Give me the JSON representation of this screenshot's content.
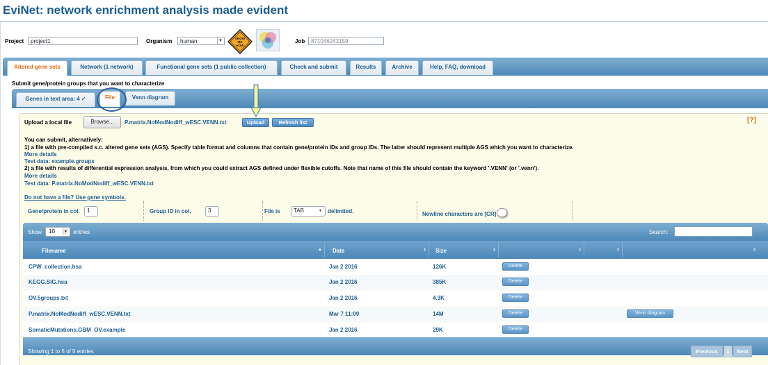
{
  "app": {
    "title": "EviNet: network enrichment analysis made evident"
  },
  "header": {
    "project_label": "Project",
    "project_value": "project1",
    "organism_label": "Organism",
    "organism_value": "human",
    "sign_text": "SHOW ME HOW",
    "job_label": "Job",
    "job_value": "871046243159"
  },
  "tabs": [
    {
      "label": "Altered gene sets"
    },
    {
      "label": "Network (1 network)"
    },
    {
      "label": "Functional gene sets (1 public collection)"
    },
    {
      "label": "Check and submit"
    },
    {
      "label": "Results"
    },
    {
      "label": "Archive"
    },
    {
      "label": "Help, FAQ, download"
    }
  ],
  "submit_title": "Submit gene/protein groups that you want to characterize",
  "subtabs": [
    {
      "label": "Genes in text area: 4 ✓"
    },
    {
      "label": "File"
    },
    {
      "label": "Venn diagram"
    }
  ],
  "upload": {
    "label": "Upload a local file",
    "browse": "Browse...",
    "filename": "P.matrix.NoModNodiff_wESC.VENN.txt",
    "upload_btn": "Upload",
    "refresh_btn": "Refresh list",
    "help": "[?]"
  },
  "info": {
    "line1": "You can submit, alternatively:",
    "line2": "1) a file with pre-compiled s.c. altered gene sets (AGS). Specify table format and columns that contain gene/protein IDs and group IDs. The latter should represent multiple AGS which you want to characterize.",
    "more1": "More details",
    "test1": "Test data: example.groups",
    "line3": "2) a file with results of differential expression analysis, from which you could extract AGS defined under flexible cutoffs. Note that name of this file should contain the keyword '.VENN' (or '.venn').",
    "more2": "More details",
    "test2": "Test data: P.matrix.NoModNodiff_wESC.VENN.txt",
    "no_file": "Do not have a file? Use gene symbols."
  },
  "options": {
    "gene_col_label": "Gene/protein in col.",
    "gene_col_value": "1",
    "group_col_label": "Group ID in col.",
    "group_col_value": "3",
    "file_is_label": "File is",
    "delim_value": "TAB",
    "delimited_label": "delimited.",
    "newline_label": "Newline characters are [CR]"
  },
  "table": {
    "show_label": "Show",
    "entries_value": "10",
    "entries_label": "entries",
    "search_label": "Search:",
    "columns": [
      "Filename",
      "Date",
      "Size"
    ],
    "rows": [
      {
        "filename": "CPW_collection.hsa",
        "date": "Jan 2 2016",
        "size": "126K",
        "delete": "Delete",
        "venn": ""
      },
      {
        "filename": "KEGG.SIG.hsa",
        "date": "Jan 2 2016",
        "size": "385K",
        "delete": "Delete",
        "venn": ""
      },
      {
        "filename": "OV.5groups.txt",
        "date": "Jan 2 2016",
        "size": "4.3K",
        "delete": "Delete",
        "venn": ""
      },
      {
        "filename": "P.matrix.NoModNodiff_wESC.VENN.txt",
        "date": "Mar 7 11:09",
        "size": "14M",
        "delete": "Delete",
        "venn": "Venn diagram"
      },
      {
        "filename": "SomaticMutations.GBM_OV.example",
        "date": "Jan 2 2016",
        "size": "29K",
        "delete": "Delete",
        "venn": ""
      }
    ],
    "footer_info": "Showing 1 to 5 of 5 entries",
    "prev": "Previous",
    "page": "1",
    "next": "Next"
  }
}
